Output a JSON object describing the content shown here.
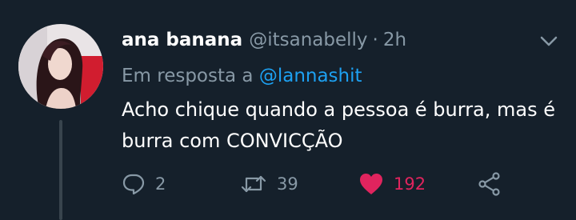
{
  "tweet": {
    "display_name": "ana banana",
    "handle": "@itsanabelly",
    "separator": "·",
    "time": "2h",
    "reply_prefix": "Em resposta a",
    "reply_mention": "@lannashit",
    "text": "Acho chique quando a pessoa é burra, mas é burra com CONVICÇÃO",
    "actions": {
      "reply_count": "2",
      "retweet_count": "39",
      "like_count": "192"
    }
  },
  "colors": {
    "background": "#15202b",
    "secondary_text": "#8899a6",
    "accent_blue": "#1da1f2",
    "like_pink": "#e0245e",
    "thread_line": "#38444d"
  },
  "icons": {
    "caret": "chevron-down-icon",
    "reply": "reply-bubble-icon",
    "retweet": "retweet-icon",
    "like": "heart-icon",
    "share": "share-icon"
  }
}
